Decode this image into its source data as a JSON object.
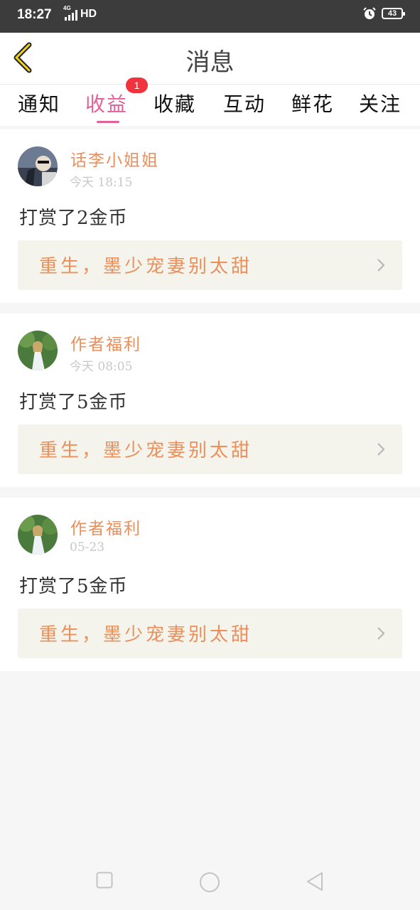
{
  "status_bar": {
    "time": "18:27",
    "network_small": "4G",
    "network_label": "HD",
    "battery": "43"
  },
  "header": {
    "title": "消息"
  },
  "tabs": [
    {
      "label": "通知"
    },
    {
      "label": "收益",
      "active": true
    },
    {
      "label": "收藏"
    },
    {
      "label": "互动"
    },
    {
      "label": "鲜花"
    },
    {
      "label": "关注"
    }
  ],
  "badge": "1",
  "messages": [
    {
      "name": "话李小姐姐",
      "time": "今天 18:15",
      "text": "打赏了2金币",
      "book": "重生，墨少宠妻别太甜"
    },
    {
      "name": "作者福利",
      "time": "今天 08:05",
      "text": "打赏了5金币",
      "book": "重生，墨少宠妻别太甜"
    },
    {
      "name": "作者福利",
      "time": "05-23",
      "text": "打赏了5金币",
      "book": "重生，墨少宠妻别太甜"
    }
  ],
  "colors": {
    "accent": "#e3609a",
    "name": "#ec8f5b",
    "badge": "#f2323c",
    "book_bg": "#f4f4ec"
  },
  "nav": [
    "square-icon",
    "circle-icon",
    "triangle-back-icon"
  ]
}
